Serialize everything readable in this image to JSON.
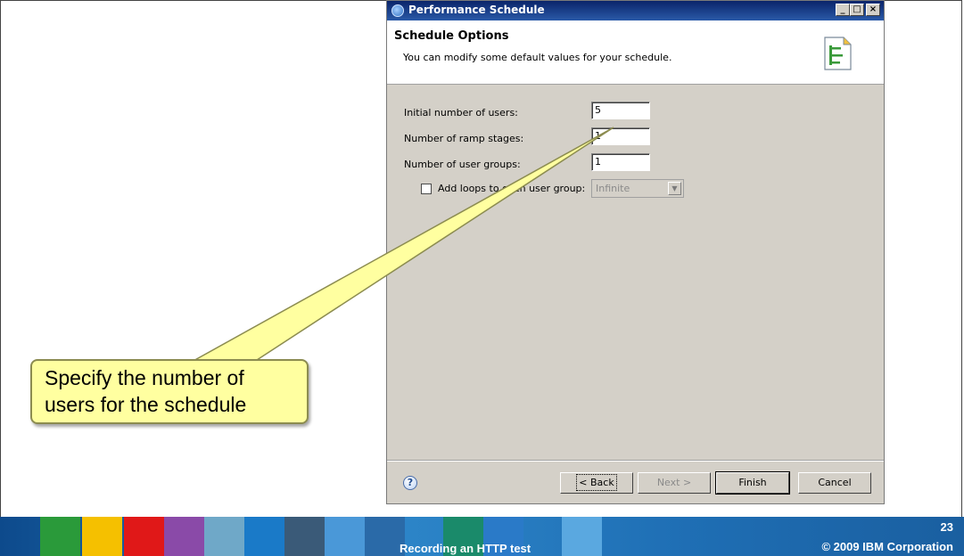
{
  "dialog": {
    "title": "Performance Schedule",
    "window_buttons": [
      "_",
      "□",
      "×"
    ],
    "header": {
      "title": "Schedule Options",
      "description": "You can modify some default values for your schedule."
    },
    "fields": [
      {
        "label": "Initial number of users:",
        "value": "5"
      },
      {
        "label": "Number of ramp stages:",
        "value": "1"
      },
      {
        "label": "Number of user groups:",
        "value": "1"
      }
    ],
    "loops": {
      "checkbox_label": "Add loops to each user group:",
      "checked": false,
      "dropdown_value": "Infinite"
    },
    "buttons": {
      "help": "?",
      "back": "< Back",
      "next": "Next >",
      "finish": "Finish",
      "cancel": "Cancel"
    }
  },
  "callout": {
    "line1": "Specify the number of",
    "line2": "users for the schedule"
  },
  "footer": {
    "title": "Recording an HTTP test",
    "page_number": "23",
    "copyright": "© 2009 IBM Corporation"
  },
  "colors": {
    "titlebar": "#0a246a",
    "dialog_bg": "#d4d0c8",
    "callout_fill": "#ffffa0",
    "footer_blue": "#1f6fb5"
  }
}
